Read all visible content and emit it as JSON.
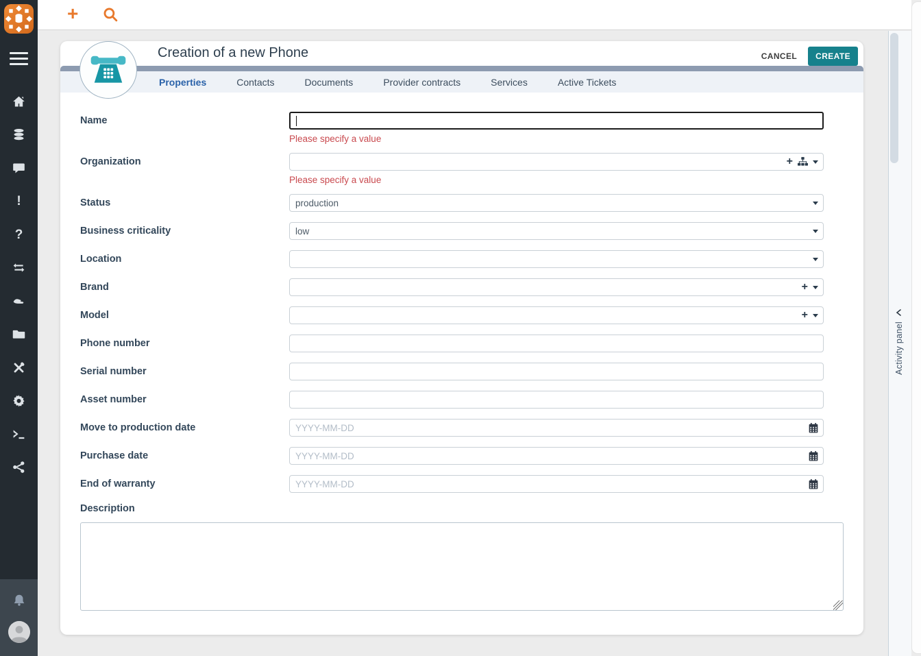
{
  "app": {
    "logo_icon": "itop-logo-icon",
    "colors": {
      "accent_orange": "#E8792C",
      "teal": "#16818C",
      "active_tab_blue": "#2A62A9",
      "error_red": "#C9494E",
      "sidebar_dark": "#242B31",
      "sidebar_bottom": "#3D464E",
      "header_bar": "#8D9BB0"
    }
  },
  "topbar": {
    "icons": [
      "plus-icon",
      "search-icon"
    ]
  },
  "sidebar": {
    "icons": [
      "hamburger-icon",
      "home-icon",
      "database-icon",
      "comment-icon",
      "exclamation-icon",
      "question-icon",
      "exchange-icon",
      "handshake-icon",
      "folder-icon",
      "tools-icon",
      "gear-icon",
      "terminal-icon",
      "share-icon"
    ],
    "bottom_icons": [
      "bell-icon",
      "user-avatar-icon"
    ]
  },
  "header": {
    "title": "Creation of a new Phone",
    "avatar_icon": "phone-icon",
    "cancel_label": "CANCEL",
    "create_label": "CREATE"
  },
  "tabs": [
    {
      "label": "Properties",
      "active": true
    },
    {
      "label": "Contacts",
      "active": false
    },
    {
      "label": "Documents",
      "active": false
    },
    {
      "label": "Provider contracts",
      "active": false
    },
    {
      "label": "Services",
      "active": false
    },
    {
      "label": "Active Tickets",
      "active": false
    }
  ],
  "form": {
    "error_message": "Please specify a value",
    "fields": [
      {
        "label": "Name",
        "type": "text",
        "value": "",
        "focused": true,
        "error": "Please specify a value"
      },
      {
        "label": "Organization",
        "type": "picker",
        "value": "",
        "icons": [
          "plus-icon",
          "hierarchy-icon",
          "caret-down-icon"
        ],
        "error": "Please specify a value"
      },
      {
        "label": "Status",
        "type": "select",
        "value": "production"
      },
      {
        "label": "Business criticality",
        "type": "select",
        "value": "low"
      },
      {
        "label": "Location",
        "type": "select",
        "value": ""
      },
      {
        "label": "Brand",
        "type": "picker",
        "value": "",
        "icons": [
          "plus-icon",
          "caret-down-icon"
        ]
      },
      {
        "label": "Model",
        "type": "picker",
        "value": "",
        "icons": [
          "plus-icon",
          "caret-down-icon"
        ]
      },
      {
        "label": "Phone number",
        "type": "text",
        "value": ""
      },
      {
        "label": "Serial number",
        "type": "text",
        "value": ""
      },
      {
        "label": "Asset number",
        "type": "text",
        "value": ""
      },
      {
        "label": "Move to production date",
        "type": "date",
        "value": "",
        "placeholder": "YYYY-MM-DD",
        "icons": [
          "calendar-icon"
        ]
      },
      {
        "label": "Purchase date",
        "type": "date",
        "value": "",
        "placeholder": "YYYY-MM-DD",
        "icons": [
          "calendar-icon"
        ]
      },
      {
        "label": "End of warranty",
        "type": "date",
        "value": "",
        "placeholder": "YYYY-MM-DD",
        "icons": [
          "calendar-icon"
        ]
      },
      {
        "label": "Description",
        "type": "textarea",
        "value": ""
      }
    ]
  },
  "activity_panel": {
    "label": "Activity panel",
    "collapse_icon": "chevron-left-icon"
  }
}
